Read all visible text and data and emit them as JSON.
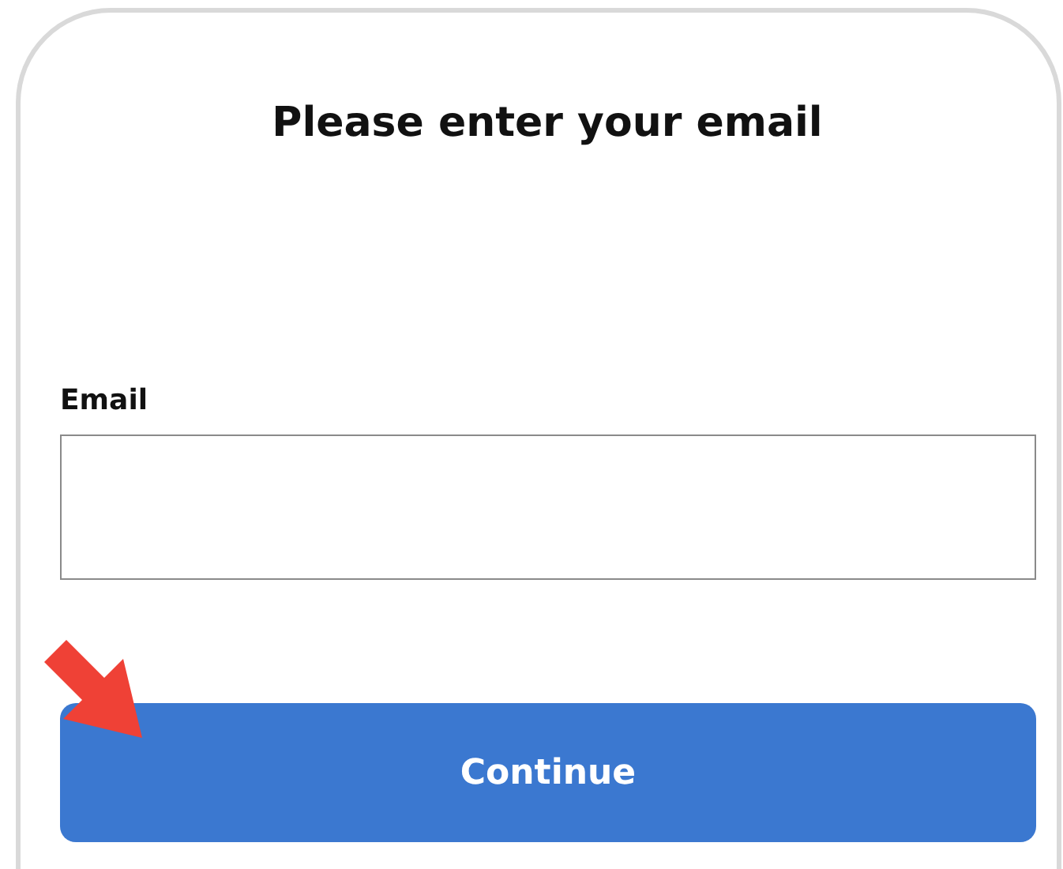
{
  "title": "Please enter your email",
  "email_field": {
    "label": "Email"
  },
  "continue_button": {
    "label": "Continue"
  }
}
